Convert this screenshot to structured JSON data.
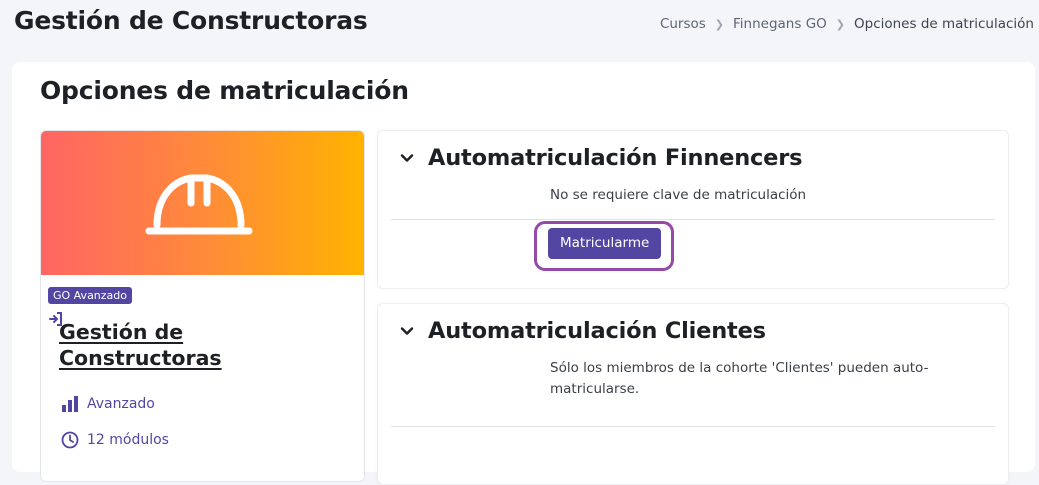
{
  "header": {
    "title": "Gestión de Constructoras",
    "breadcrumb": [
      "Cursos",
      "Finnegans GO",
      "Opciones de matriculación"
    ]
  },
  "main": {
    "title": "Opciones de matriculación"
  },
  "course": {
    "badge": "GO Avanzado",
    "name": "Gestión de Constructoras",
    "level": "Avanzado",
    "modules": "12 módulos",
    "icon": "hard-hat-icon",
    "gradient": [
      "#ff6563",
      "#ff8a3a",
      "#ffb300"
    ]
  },
  "enrol_methods": [
    {
      "title": "Automatriculación Finnencers",
      "description": "No se requiere clave de matriculación",
      "button": "Matricularme"
    },
    {
      "title": "Automatriculación Clientes",
      "description_lines": [
        "Sólo los miembros de la cohorte 'Clientes' pueden auto-",
        "matricularse."
      ]
    }
  ],
  "colors": {
    "accent": "#5346a3",
    "highlight": "#9549a8",
    "background": "#f4f5f8"
  }
}
